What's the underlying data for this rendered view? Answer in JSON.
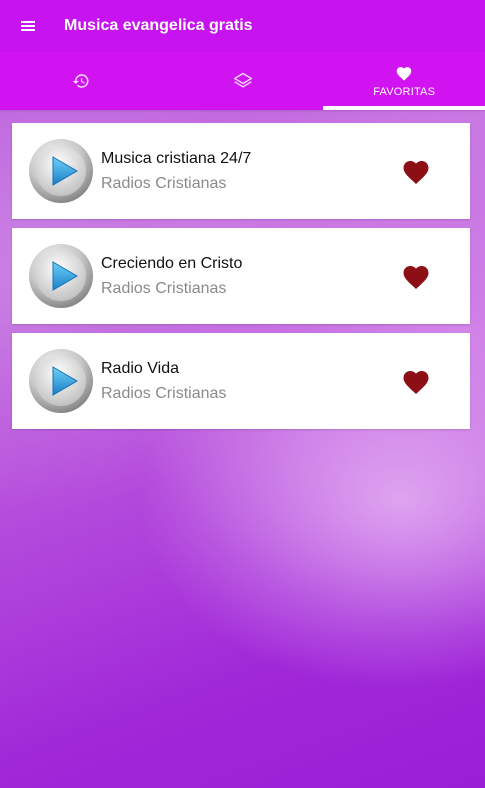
{
  "header": {
    "title": "Musica evangelica gratis",
    "menu_icon": "hamburger-menu-icon"
  },
  "tabs": [
    {
      "icon": "history-icon",
      "label": "",
      "active": false
    },
    {
      "icon": "layers-icon",
      "label": "",
      "active": false
    },
    {
      "icon": "heart-icon",
      "label": "FAVORITAS",
      "active": true
    }
  ],
  "stations": [
    {
      "title": "Musica cristiana 24/7",
      "subtitle": "Radios Cristianas",
      "favorite": true
    },
    {
      "title": "Creciendo en Cristo",
      "subtitle": "Radios Cristianas",
      "favorite": true
    },
    {
      "title": "Radio Vida",
      "subtitle": "Radios Cristianas",
      "favorite": true
    }
  ],
  "colors": {
    "appbar": "#c613f0",
    "tabbar": "#d113f2",
    "favorite_heart": "#8b0f14",
    "play_blue": "#2a9ee0"
  }
}
